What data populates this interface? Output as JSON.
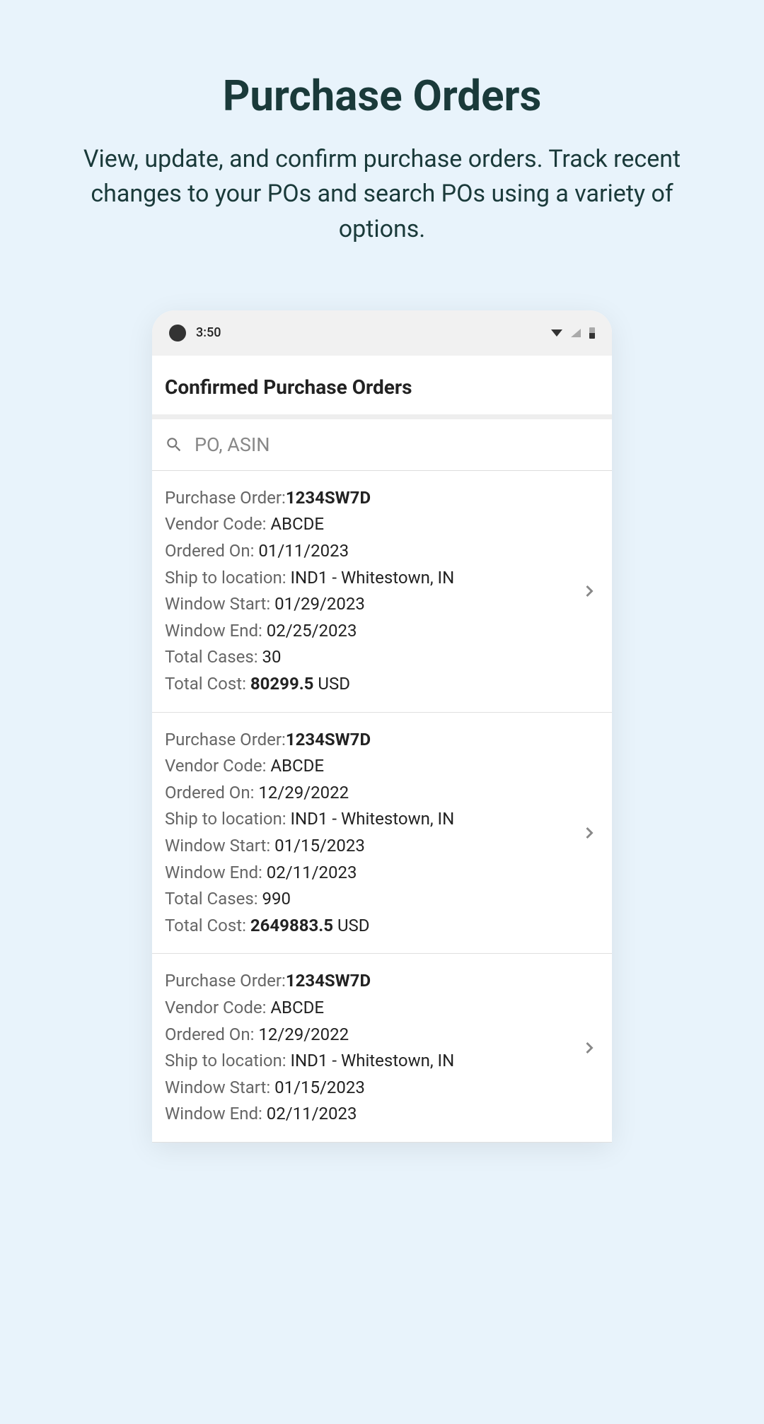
{
  "hero": {
    "title": "Purchase Orders",
    "description": "View, update, and confirm purchase orders. Track recent changes to your POs and search POs using a variety of options."
  },
  "statusBar": {
    "time": "3:50"
  },
  "screen": {
    "header": "Confirmed Purchase Orders",
    "searchPlaceholder": "PO, ASIN"
  },
  "labels": {
    "purchaseOrder": "Purchase Order:",
    "vendorCode": "Vendor Code: ",
    "orderedOn": "Ordered On: ",
    "shipTo": "Ship to location: ",
    "windowStart": "Window Start: ",
    "windowEnd": "Window End: ",
    "totalCases": "Total Cases: ",
    "totalCost": "Total Cost: "
  },
  "orders": [
    {
      "po": "1234SW7D",
      "vendor": "ABCDE",
      "orderedOn": "01/11/2023",
      "shipTo": "IND1 - Whitestown, IN",
      "windowStart": "01/29/2023",
      "windowEnd": "02/25/2023",
      "totalCases": "30",
      "totalCost": "80299.5",
      "currency": " USD"
    },
    {
      "po": "1234SW7D",
      "vendor": "ABCDE",
      "orderedOn": "12/29/2022",
      "shipTo": "IND1 - Whitestown, IN",
      "windowStart": "01/15/2023",
      "windowEnd": "02/11/2023",
      "totalCases": "990",
      "totalCost": "2649883.5",
      "currency": " USD"
    },
    {
      "po": "1234SW7D",
      "vendor": "ABCDE",
      "orderedOn": "12/29/2022",
      "shipTo": "IND1 - Whitestown, IN",
      "windowStart": "01/15/2023",
      "windowEnd": "02/11/2023",
      "totalCases": "",
      "totalCost": "",
      "currency": ""
    }
  ]
}
